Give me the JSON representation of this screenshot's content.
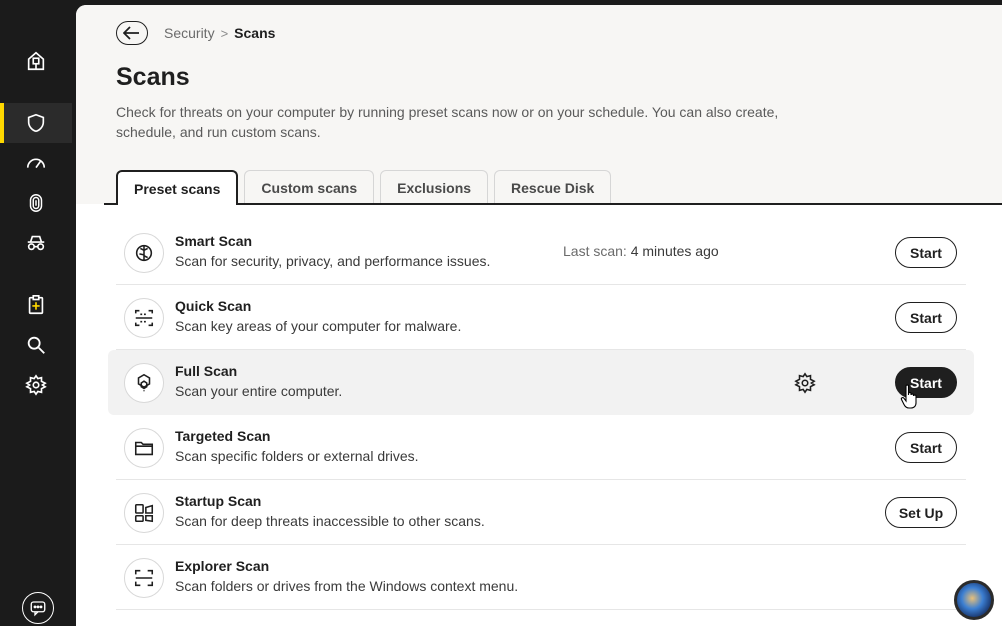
{
  "sidebar": {
    "items": [
      {
        "name": "home-icon"
      },
      {
        "name": "shield-icon",
        "active": true
      },
      {
        "name": "speedometer-icon"
      },
      {
        "name": "fingerprint-icon"
      },
      {
        "name": "incognito-icon"
      },
      {
        "name": "clipboard-plus-icon"
      },
      {
        "name": "search-icon"
      },
      {
        "name": "gear-icon"
      }
    ],
    "bottom_icon": "chat-icon"
  },
  "header": {
    "breadcrumb": {
      "parent": "Security",
      "separator": ">",
      "current": "Scans"
    },
    "title": "Scans",
    "description": "Check for threats on your computer by running preset scans now or on your schedule. You can also create, schedule, and run custom scans."
  },
  "tabs": [
    {
      "label": "Preset scans",
      "active": true
    },
    {
      "label": "Custom scans"
    },
    {
      "label": "Exclusions"
    },
    {
      "label": "Rescue Disk"
    }
  ],
  "scans": [
    {
      "title": "Smart Scan",
      "desc": "Scan for security, privacy, and performance issues.",
      "button": "Start",
      "icon": "smart-scan-icon",
      "last_scan_label": "Last scan:",
      "last_scan_value": "4 minutes ago"
    },
    {
      "title": "Quick Scan",
      "desc": "Scan key areas of your computer for malware.",
      "button": "Start",
      "icon": "quick-scan-icon"
    },
    {
      "title": "Full Scan",
      "desc": "Scan your entire computer.",
      "button": "Start",
      "icon": "full-scan-icon",
      "hover": true
    },
    {
      "title": "Targeted Scan",
      "desc": "Scan specific folders or external drives.",
      "button": "Start",
      "icon": "folder-icon"
    },
    {
      "title": "Startup Scan",
      "desc": "Scan for deep threats inaccessible to other scans.",
      "button": "Set Up",
      "icon": "startup-scan-icon"
    },
    {
      "title": "Explorer Scan",
      "desc": "Scan folders or drives from the Windows context menu.",
      "icon": "explorer-scan-icon"
    }
  ],
  "colors": {
    "accent": "#ffd800",
    "sidebar": "#1b1b1b",
    "header_bg": "#f7f6f4"
  }
}
